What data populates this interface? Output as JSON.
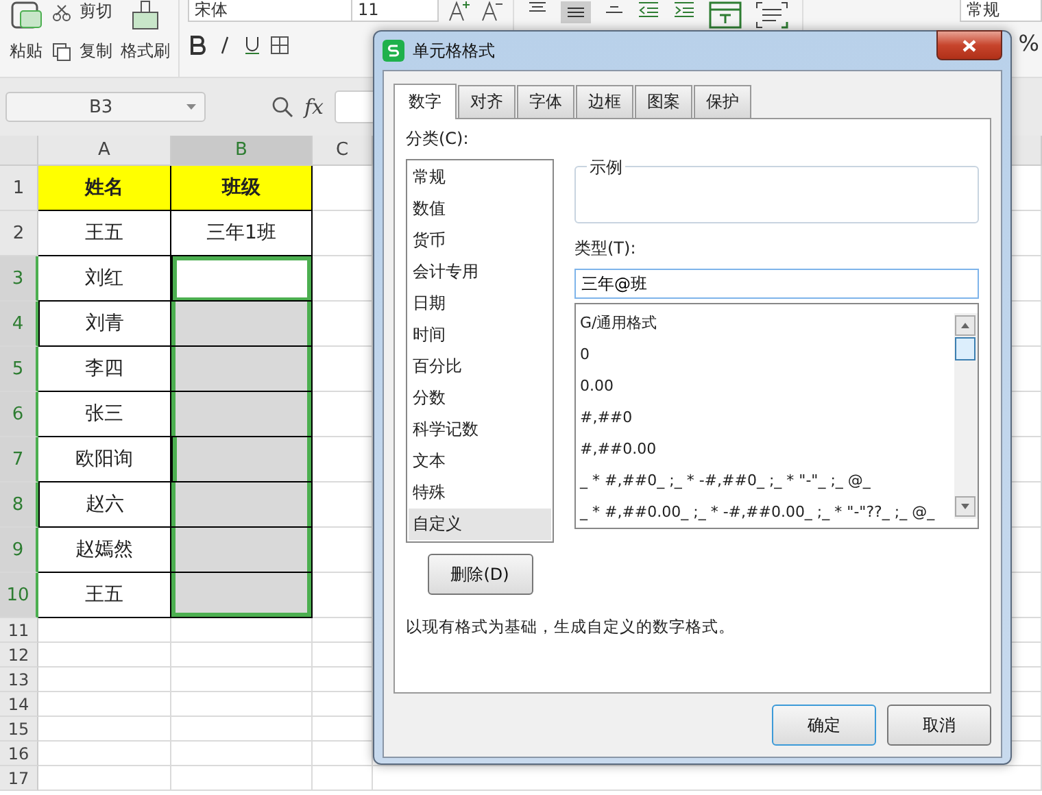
{
  "toolbar": {
    "paste": "粘贴",
    "cut": "剪切",
    "copy": "复制",
    "format_painter": "格式刷",
    "font": "宋体",
    "font_size": "11",
    "number_format": "常规",
    "percent": "%"
  },
  "formula_bar": {
    "cell_ref": "B3",
    "fx": "fx"
  },
  "sheet": {
    "columns": [
      {
        "label": "A",
        "selected": false
      },
      {
        "label": "B",
        "selected": true
      },
      {
        "label": "C",
        "selected": false
      }
    ],
    "rows": [
      {
        "number": "1",
        "kind": "header",
        "selected": false,
        "active": false,
        "cells": [
          "姓名",
          "班级"
        ]
      },
      {
        "number": "2",
        "kind": "data",
        "selected": false,
        "active": false,
        "cells": [
          "王五",
          "三年1班"
        ]
      },
      {
        "number": "3",
        "kind": "data",
        "selected": true,
        "active": true,
        "cells": [
          "刘红",
          ""
        ]
      },
      {
        "number": "4",
        "kind": "data",
        "selected": true,
        "active": false,
        "cells": [
          "刘青",
          ""
        ]
      },
      {
        "number": "5",
        "kind": "data",
        "selected": true,
        "active": false,
        "cells": [
          "李四",
          ""
        ]
      },
      {
        "number": "6",
        "kind": "data",
        "selected": true,
        "active": false,
        "cells": [
          "张三",
          ""
        ]
      },
      {
        "number": "7",
        "kind": "data",
        "selected": true,
        "active": false,
        "cells": [
          "欧阳询",
          ""
        ]
      },
      {
        "number": "8",
        "kind": "data",
        "selected": true,
        "active": false,
        "cells": [
          "赵六",
          ""
        ]
      },
      {
        "number": "9",
        "kind": "data",
        "selected": true,
        "active": false,
        "cells": [
          "赵嫣然",
          ""
        ]
      },
      {
        "number": "10",
        "kind": "data",
        "selected": true,
        "active": false,
        "cells": [
          "王五",
          ""
        ]
      },
      {
        "number": "11",
        "kind": "empty",
        "selected": false,
        "active": false,
        "cells": []
      },
      {
        "number": "12",
        "kind": "empty",
        "selected": false,
        "active": false,
        "cells": []
      },
      {
        "number": "13",
        "kind": "empty",
        "selected": false,
        "active": false,
        "cells": []
      },
      {
        "number": "14",
        "kind": "empty",
        "selected": false,
        "active": false,
        "cells": []
      },
      {
        "number": "15",
        "kind": "empty",
        "selected": false,
        "active": false,
        "cells": []
      },
      {
        "number": "16",
        "kind": "empty",
        "selected": false,
        "active": false,
        "cells": []
      },
      {
        "number": "17",
        "kind": "empty",
        "selected": false,
        "active": false,
        "cells": []
      }
    ]
  },
  "dialog": {
    "title": "单元格格式",
    "tabs": [
      {
        "label": "数字",
        "selected": true
      },
      {
        "label": "对齐",
        "selected": false
      },
      {
        "label": "字体",
        "selected": false
      },
      {
        "label": "边框",
        "selected": false
      },
      {
        "label": "图案",
        "selected": false
      },
      {
        "label": "保护",
        "selected": false
      }
    ],
    "category_label": "分类(C):",
    "categories": [
      {
        "label": "常规",
        "selected": false
      },
      {
        "label": "数值",
        "selected": false
      },
      {
        "label": "货币",
        "selected": false
      },
      {
        "label": "会计专用",
        "selected": false
      },
      {
        "label": "日期",
        "selected": false
      },
      {
        "label": "时间",
        "selected": false
      },
      {
        "label": "百分比",
        "selected": false
      },
      {
        "label": "分数",
        "selected": false
      },
      {
        "label": "科学记数",
        "selected": false
      },
      {
        "label": "文本",
        "selected": false
      },
      {
        "label": "特殊",
        "selected": false
      },
      {
        "label": "自定义",
        "selected": true
      }
    ],
    "sample_label": "示例",
    "type_label": "类型(T):",
    "type_value": "三年@班",
    "formats": [
      "G/通用格式",
      "0",
      "0.00",
      "#,##0",
      "#,##0.00",
      "_ * #,##0_ ;_ * -#,##0_ ;_ * \"-\"_ ;_ @_",
      "_ * #,##0.00_ ;_ * -#,##0.00_ ;_ * \"-\"??_ ;_ @_"
    ],
    "delete_button": "删除(D)",
    "description": "以现有格式为基础，生成自定义的数字格式。",
    "ok_button": "确定",
    "cancel_button": "取消"
  }
}
